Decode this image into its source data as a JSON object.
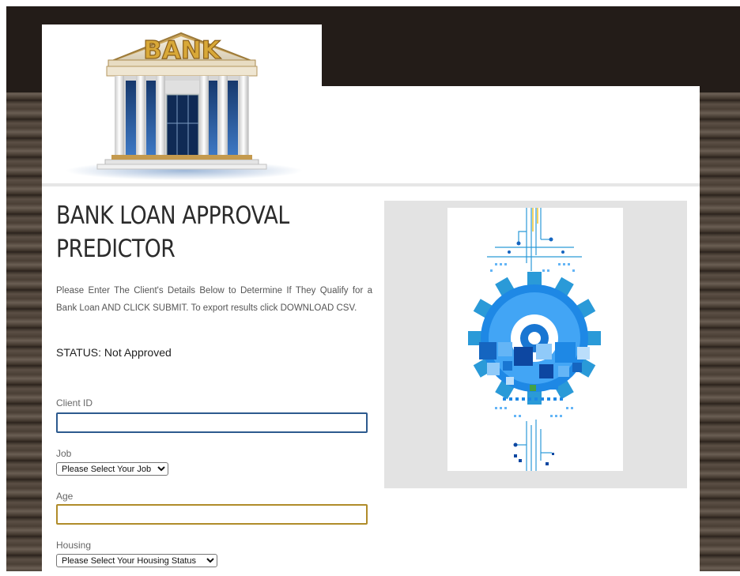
{
  "header": {
    "logo_text": "BANK"
  },
  "main": {
    "title": "BANK LOAN APPROVAL PREDICTOR",
    "description": "Please Enter The Client's Details Below to Determine If They Qualify for a Bank Loan AND CLICK SUBMIT. To export results click DOWNLOAD CSV.",
    "status": "STATUS: Not Approved"
  },
  "form": {
    "client_id": {
      "label": "Client ID",
      "value": ""
    },
    "job": {
      "label": "Job",
      "selected": "Please Select Your Job"
    },
    "age": {
      "label": "Age",
      "value": ""
    },
    "housing": {
      "label": "Housing",
      "selected": "Please Select Your Housing Status"
    }
  },
  "colors": {
    "top_band": "#231c18",
    "wood": "#4a3f35",
    "client_id_border": "#2d5a8e",
    "age_border": "#b08c2a",
    "gear_blue": "#2a9ad8"
  },
  "icons": {
    "logo": "bank-building-icon",
    "illustration": "gear-circuit-illustration"
  }
}
